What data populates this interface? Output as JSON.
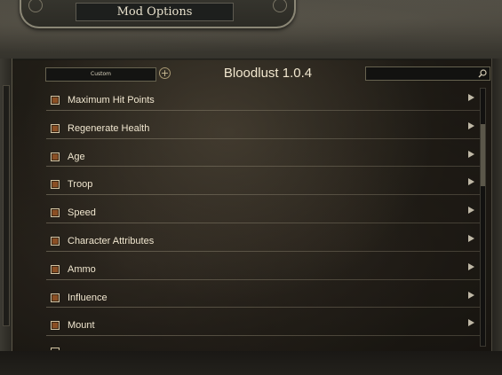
{
  "window": {
    "title": "Mod Options"
  },
  "panel": {
    "preset_label": "Custom",
    "add_glyph": "+",
    "mod_title": "Bloodlust 1.0.4",
    "search": {
      "value": "",
      "placeholder": ""
    }
  },
  "rows": [
    {
      "label": "Maximum Hit Points"
    },
    {
      "label": "Regenerate Health"
    },
    {
      "label": "Age"
    },
    {
      "label": "Troop"
    },
    {
      "label": "Speed"
    },
    {
      "label": "Character Attributes"
    },
    {
      "label": "Ammo"
    },
    {
      "label": "Influence"
    },
    {
      "label": "Mount"
    }
  ],
  "colors": {
    "checkbox_fill": "#8b4f24",
    "text": "#f0e6cf",
    "divider": "#8c8470"
  },
  "icons": {
    "add": "plus-circle-icon",
    "search": "search-icon",
    "row_arrow": "triangle-right-icon"
  }
}
